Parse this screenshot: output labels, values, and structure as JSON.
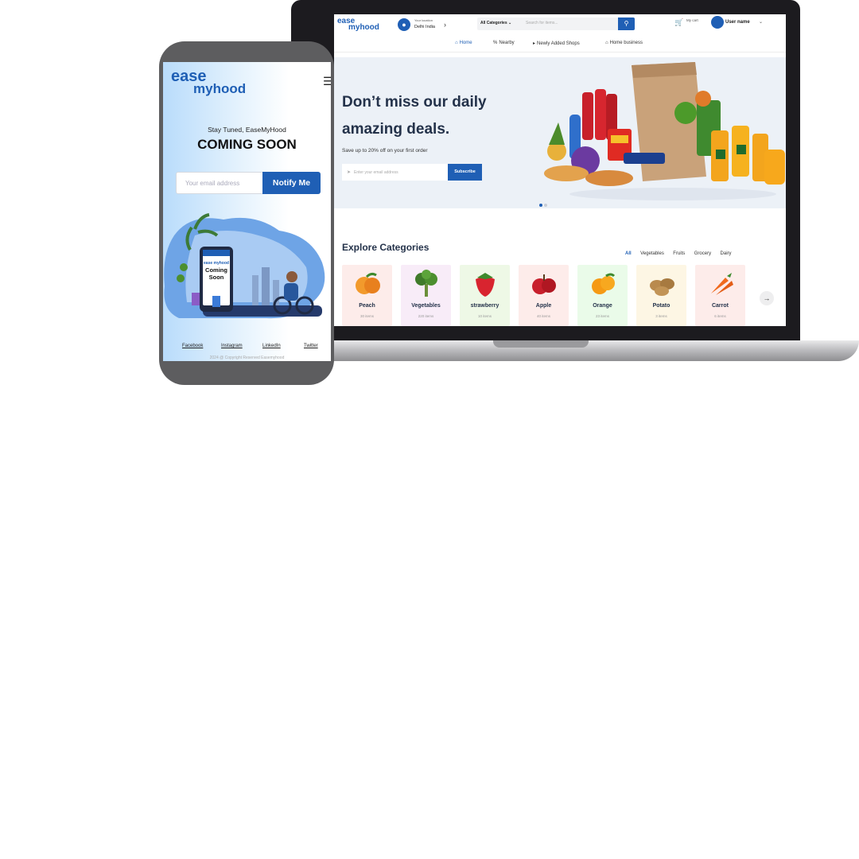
{
  "desktop": {
    "logo": {
      "line1": "ease",
      "line2": "myhood"
    },
    "location": {
      "label": "Your location",
      "value": "Delhi India"
    },
    "search": {
      "category": "All Categories",
      "placeholder": "Search for items..."
    },
    "cart_label": "My cart",
    "user_name": "User name",
    "nav": [
      "Home",
      "Nearby",
      "Newly Added Shops",
      "Home business"
    ],
    "hero": {
      "title": "Don’t miss our daily amazing deals.",
      "subtitle": "Save up to 20% off on your first order",
      "email_placeholder": "Enter your email address",
      "button": "Subscribe"
    },
    "categories": {
      "title": "Explore Categories",
      "filters": [
        "All",
        "Vegetables",
        "Fruits",
        "Grocery",
        "Dairy"
      ],
      "items": [
        {
          "name": "Peach",
          "count": "30 items",
          "bg": "#fdecea"
        },
        {
          "name": "Vegetables",
          "count": "220 items",
          "bg": "#f8ecf8"
        },
        {
          "name": "strawberry",
          "count": "10 items",
          "bg": "#eef8e6"
        },
        {
          "name": "Apple",
          "count": "40 items",
          "bg": "#fdecea"
        },
        {
          "name": "Orange",
          "count": "23 items",
          "bg": "#eafbe9"
        },
        {
          "name": "Potato",
          "count": "3 items",
          "bg": "#fdf6e4"
        },
        {
          "name": "Carrot",
          "count": "6 items",
          "bg": "#fdecea"
        }
      ]
    }
  },
  "mobile": {
    "logo": {
      "line1": "ease",
      "line2": "myhood"
    },
    "tagline": "Stay Tuned, EaseMyHood",
    "title": "COMING SOON",
    "email_placeholder": "Your email address",
    "button": "Notify Me",
    "illustration_text": {
      "brand": "ease myhood",
      "line1": "Coming",
      "line2": "Soon"
    },
    "social": [
      "Facebook",
      "Instagram",
      "LinkedIn",
      "Twitter"
    ],
    "copyright": "2024 @ Copyright Reserved Easemyhood"
  },
  "colors": {
    "brand": "#1f5fb5",
    "heading": "#24324a"
  }
}
